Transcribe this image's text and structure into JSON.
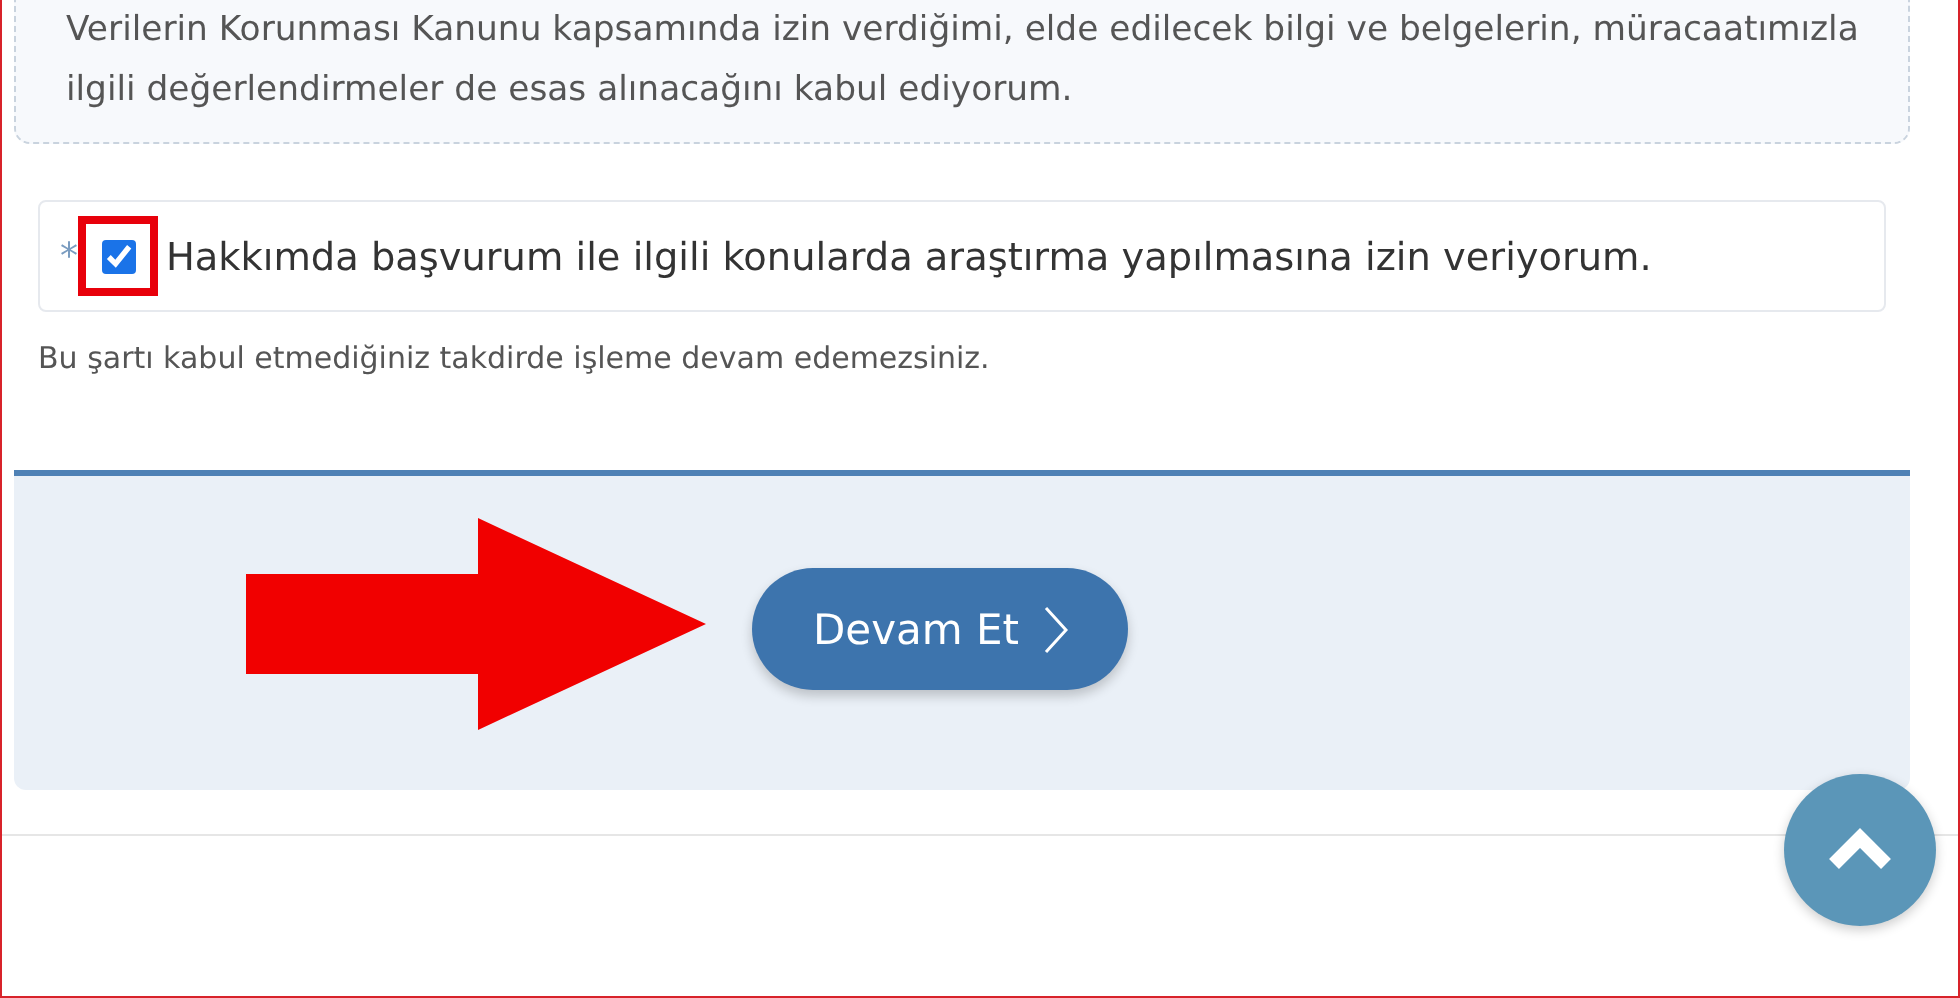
{
  "consent_text": "Verilerin Korunması Kanunu kapsamında izin verdiğimi, elde edilecek bilgi ve belgelerin, müracaatımızla ilgili değerlendirmeler de esas alınacağını kabul ediyorum.",
  "consent_checkbox": {
    "required_mark": "*",
    "label": "Hakkımda başvurum ile ilgili konularda araştırma yapılmasına izin veriyorum.",
    "checked": true
  },
  "hint": "Bu şartı kabul etmediğiniz takdirde işleme devam edemezsiniz.",
  "continue_button": {
    "label": "Devam Et"
  }
}
